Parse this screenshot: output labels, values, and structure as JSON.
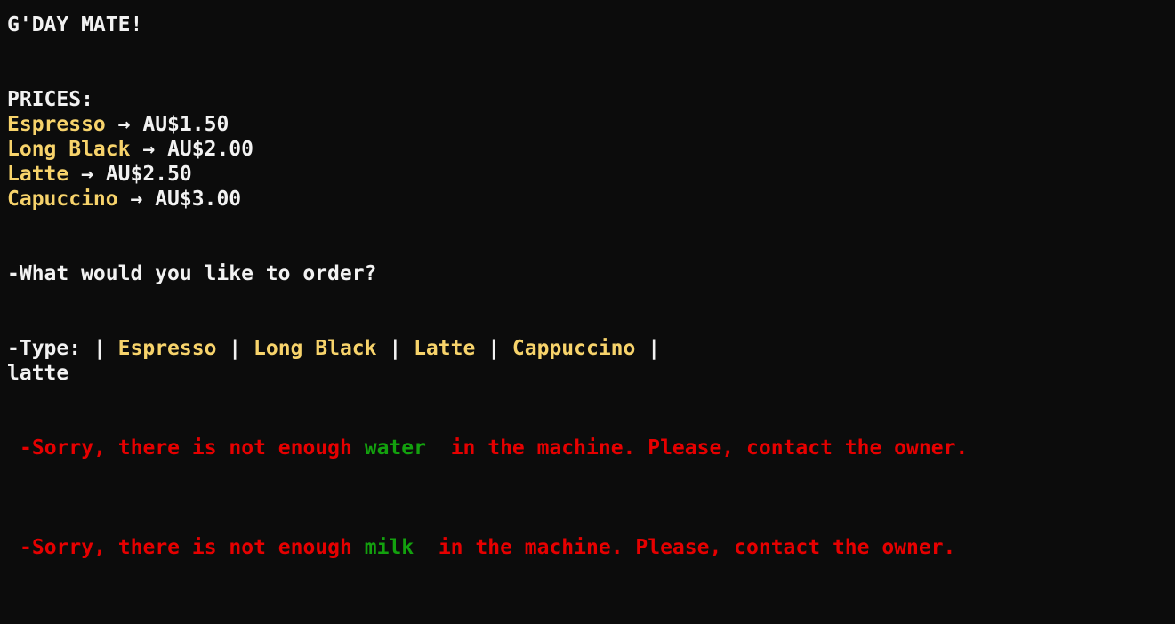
{
  "greeting": "G'DAY MATE!",
  "prices": {
    "heading": "PRICES:",
    "arrow": "→",
    "items": [
      {
        "name": "Espresso",
        "price": "AU$1.50"
      },
      {
        "name": "Long Black",
        "price": "AU$2.00"
      },
      {
        "name": "Latte",
        "price": "AU$2.50"
      },
      {
        "name": "Capuccino",
        "price": "AU$3.00"
      }
    ]
  },
  "question": "-What would you like to order?",
  "type_prompt": {
    "prefix": "-Type: ",
    "sep": "|",
    "options": [
      "Espresso",
      "Long Black",
      "Latte",
      "Cappuccino"
    ]
  },
  "user_input": "latte",
  "errors": [
    {
      "prefix": "-Sorry, there is not enough",
      "resource": "water",
      "suffix": "in the machine. Please, contact the owner."
    },
    {
      "prefix": "-Sorry, there is not enough",
      "resource": "milk",
      "suffix": "in the machine. Please, contact the owner."
    }
  ],
  "colors": {
    "background": "#0c0c0c",
    "text": "#f2f2f2",
    "item": "#f7d36b",
    "error": "#e60000",
    "resource": "#13a10e"
  }
}
